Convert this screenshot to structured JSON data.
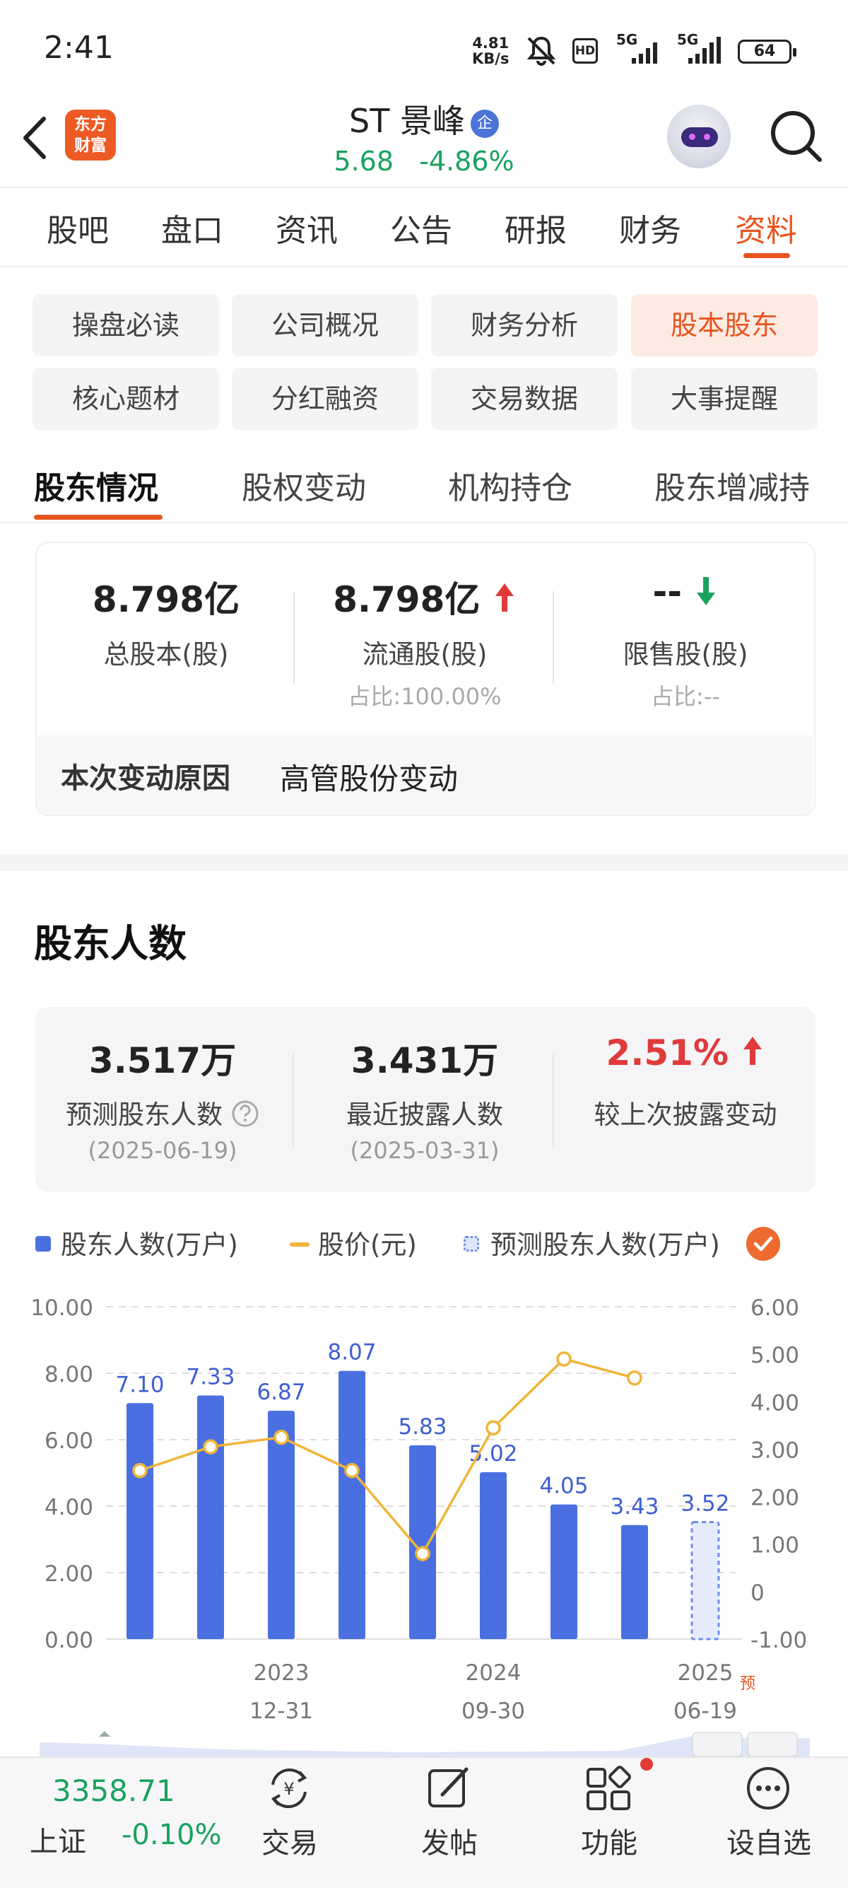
{
  "status_bar": {
    "time": "2:41",
    "net_speed": "4.81",
    "net_unit": "KB/s",
    "hd_label": "HD",
    "network1": "5G",
    "network2": "5G",
    "battery": "64"
  },
  "header": {
    "logo_line1": "东方",
    "logo_line2": "财富",
    "stock_name": "ST 景峰",
    "badge": "企",
    "price": "5.68",
    "change_pct": "-4.86%"
  },
  "main_tabs": [
    {
      "label": "股吧"
    },
    {
      "label": "盘口"
    },
    {
      "label": "资讯"
    },
    {
      "label": "公告"
    },
    {
      "label": "研报"
    },
    {
      "label": "财务"
    },
    {
      "label": "资料",
      "active": true
    }
  ],
  "chips": [
    {
      "label": "操盘必读"
    },
    {
      "label": "公司概况"
    },
    {
      "label": "财务分析"
    },
    {
      "label": "股本股东",
      "active": true
    },
    {
      "label": "核心题材"
    },
    {
      "label": "分红融资"
    },
    {
      "label": "交易数据"
    },
    {
      "label": "大事提醒"
    }
  ],
  "sub_tabs": [
    {
      "label": "股东情况",
      "active": true
    },
    {
      "label": "股权变动"
    },
    {
      "label": "机构持仓"
    },
    {
      "label": "股东增减持"
    }
  ],
  "share_capital": {
    "total": {
      "value": "8.798亿",
      "label": "总股本(股)"
    },
    "float": {
      "value": "8.798亿",
      "label": "流通股(股)",
      "ratio": "占比:100.00%"
    },
    "restricted": {
      "value": "--",
      "label": "限售股(股)",
      "ratio": "占比:--"
    },
    "reason_title": "本次变动原因",
    "reason_text": "高管股份变动"
  },
  "shareholders": {
    "section_title": "股东人数",
    "forecast": {
      "value": "3.517万",
      "label": "预测股东人数",
      "date": "(2025-06-19)"
    },
    "latest": {
      "value": "3.431万",
      "label": "最近披露人数",
      "date": "(2025-03-31)"
    },
    "change": {
      "value": "2.51%",
      "label": "较上次披露变动"
    }
  },
  "legend": {
    "holders": "股东人数(万户)",
    "price": "股价(元)",
    "forecast": "预测股东人数(万户)"
  },
  "colors": {
    "accent": "#e8541e",
    "up_red": "#e03a3a",
    "down_green": "#1aa260",
    "bar_blue": "#4a6fe0",
    "price_line": "#f0b43a"
  },
  "chart_data": {
    "type": "bar",
    "series": [
      {
        "name": "股东人数(万户)",
        "type": "bar",
        "axis": "left",
        "values": [
          7.1,
          7.33,
          6.87,
          8.07,
          5.83,
          5.02,
          4.05,
          3.43,
          3.52
        ],
        "labels": [
          "7.10",
          "7.33",
          "6.87",
          "8.07",
          "5.83",
          "5.02",
          "4.05",
          "3.43",
          "3.52"
        ],
        "forecast_last": true
      },
      {
        "name": "股价(元)",
        "type": "line",
        "axis": "right",
        "values": [
          2.55,
          3.05,
          3.25,
          2.55,
          0.8,
          3.45,
          4.9,
          4.5,
          null
        ]
      }
    ],
    "x_ticks": [
      {
        "index": 2,
        "line1": "2023",
        "line2": "12-31"
      },
      {
        "index": 5,
        "line1": "2024",
        "line2": "09-30"
      },
      {
        "index": 8,
        "line1": "2025",
        "line2": "06-19",
        "tag": "预"
      }
    ],
    "left_axis": {
      "ylim": [
        0,
        10
      ],
      "ticks": [
        "0.00",
        "2.00",
        "4.00",
        "6.00",
        "8.00",
        "10.00"
      ]
    },
    "right_axis": {
      "ylim": [
        -1,
        6
      ],
      "ticks": [
        "-1.00",
        "0",
        "1.00",
        "2.00",
        "3.00",
        "4.00",
        "5.00",
        "6.00"
      ]
    },
    "grid": true
  },
  "bottom_bar": {
    "index_value": "3358.71",
    "index_name": "上证",
    "index_change": "-0.10%",
    "nav": [
      {
        "label": "交易",
        "icon": "trade-yen-icon"
      },
      {
        "label": "发帖",
        "icon": "post-pen-icon"
      },
      {
        "label": "功能",
        "icon": "function-grid-icon"
      },
      {
        "label": "设自选",
        "icon": "more-dots-icon"
      }
    ]
  }
}
